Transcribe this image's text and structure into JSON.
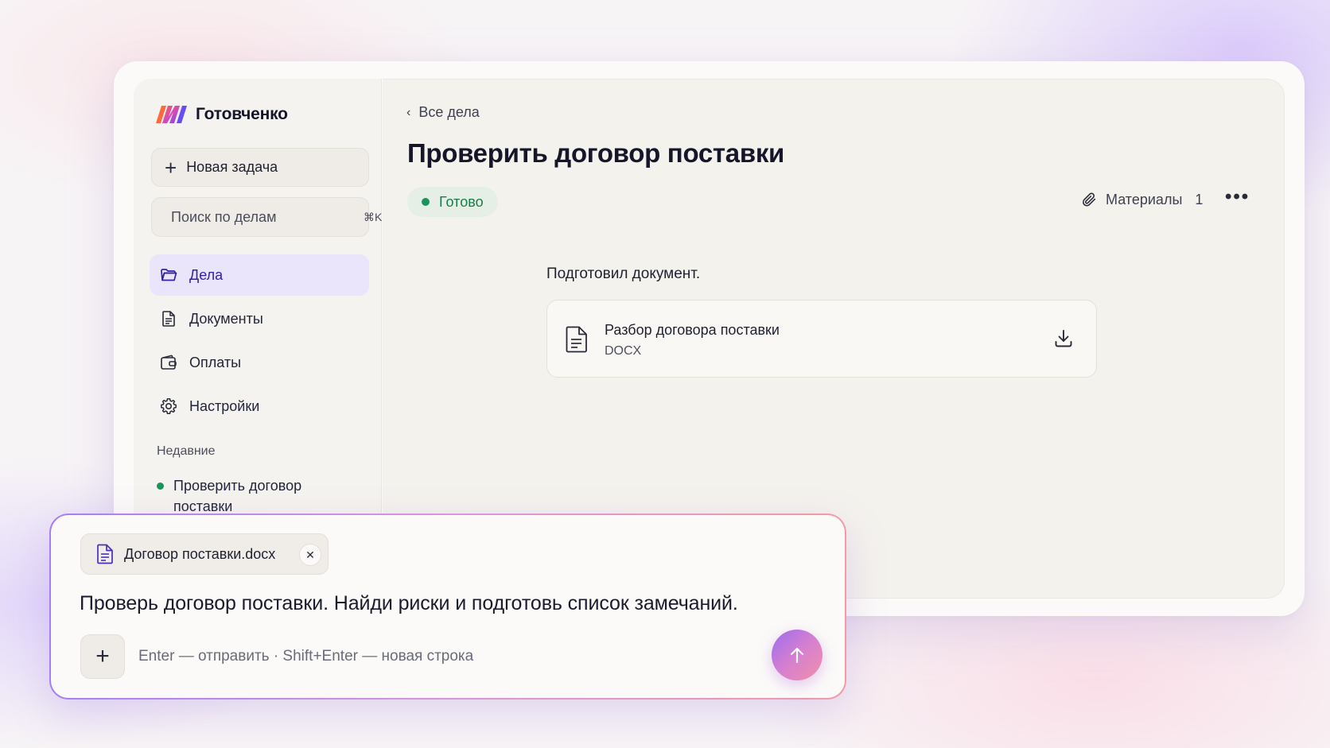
{
  "app": {
    "name": "Готовченко",
    "accent": "#3322a8",
    "status_color": "#19955b"
  },
  "sidebar": {
    "new_task_label": "Новая задача",
    "search_placeholder": "Поиск по делам",
    "search_shortcut": "⌘K",
    "items": [
      {
        "label": "Дела",
        "icon": "folder-icon",
        "active": true
      },
      {
        "label": "Документы",
        "icon": "document-icon",
        "active": false
      },
      {
        "label": "Оплаты",
        "icon": "wallet-icon",
        "active": false
      },
      {
        "label": "Настройки",
        "icon": "gear-icon",
        "active": false
      }
    ],
    "recent_title": "Недавние",
    "recent_items": [
      {
        "label": "Проверить договор поставки",
        "status": "done"
      }
    ]
  },
  "main": {
    "breadcrumb": "Все дела",
    "title": "Проверить договор поставки",
    "status": "Готово",
    "materials_label": "Материалы",
    "materials_count": "1",
    "agent_message": "Подготовил документ.",
    "document": {
      "name": "Разбор договора поставки",
      "type": "DOCX"
    }
  },
  "composer": {
    "attachment_name": "Договор поставки.docx",
    "prompt": "Проверь договор поставки. Найди риски и подготовь список замечаний.",
    "hint_placeholder": "Enter — отправить · Shift+Enter — новая строка"
  }
}
